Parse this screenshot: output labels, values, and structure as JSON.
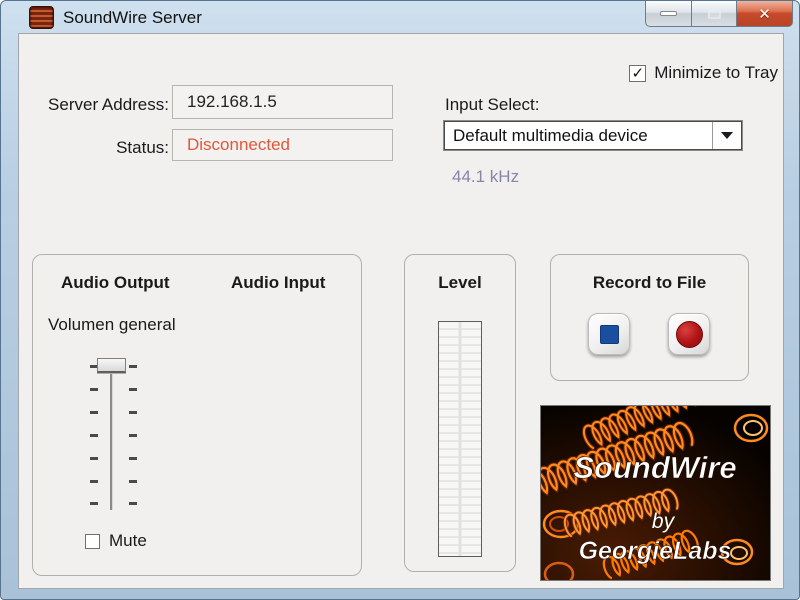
{
  "window": {
    "title": "SoundWire Server",
    "controls": {
      "minimize": "minimize",
      "maximize": "maximize",
      "close_glyph": "✕"
    }
  },
  "tray": {
    "label": "Minimize to Tray",
    "checked": true
  },
  "connection": {
    "server_address_label": "Server Address:",
    "server_address_value": "192.168.1.5",
    "status_label": "Status:",
    "status_value": "Disconnected",
    "status_color": "#e0573c"
  },
  "input": {
    "label": "Input Select:",
    "selected": "Default multimedia device",
    "sample_rate": "44.1 kHz",
    "sample_rate_color": "#8886a8"
  },
  "audio": {
    "output_header": "Audio Output",
    "input_header": "Audio Input",
    "volume_label": "Volumen general",
    "mute_label": "Mute",
    "mute_checked": false,
    "slider_position": "top"
  },
  "level": {
    "header": "Level",
    "value_percent": 0
  },
  "record": {
    "header": "Record to File"
  },
  "logo": {
    "title": "SoundWire",
    "by": "by",
    "brand": "GeorgieLabs",
    "accent": "#ff8a1e"
  }
}
